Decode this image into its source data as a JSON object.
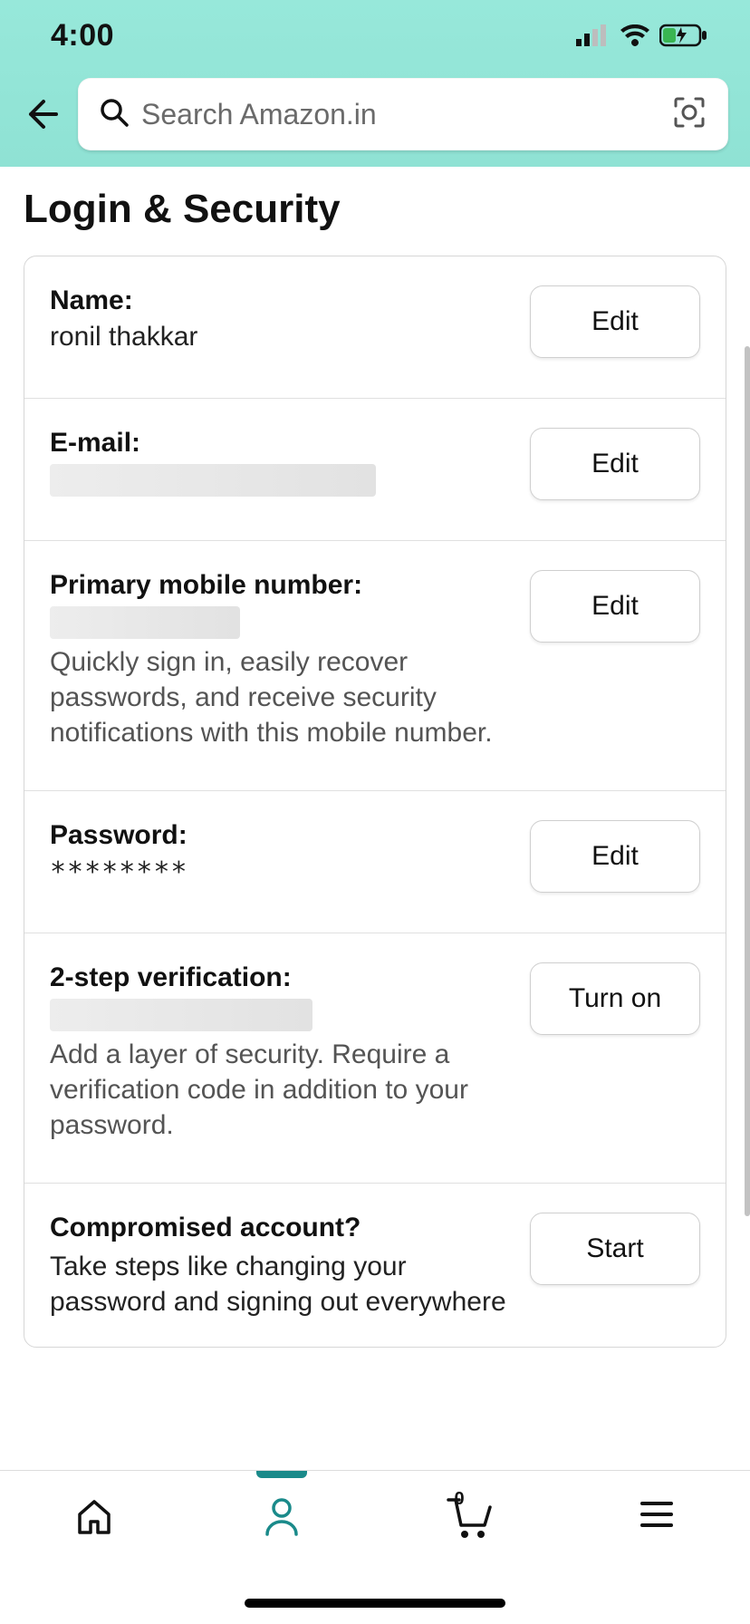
{
  "status": {
    "time": "4:00"
  },
  "search": {
    "placeholder": "Search Amazon.in"
  },
  "page": {
    "title": "Login & Security"
  },
  "rows": {
    "name": {
      "label": "Name:",
      "value": "ronil thakkar",
      "button": "Edit"
    },
    "email": {
      "label": "E-mail:",
      "value": "",
      "button": "Edit"
    },
    "mobile": {
      "label": "Primary mobile number:",
      "value": "",
      "desc": "Quickly sign in, easily recover passwords, and receive security notifications with this mobile number.",
      "button": "Edit"
    },
    "password": {
      "label": "Password:",
      "value": "********",
      "button": "Edit"
    },
    "twostep": {
      "label": "2-step verification:",
      "value": "",
      "desc": "Add a layer of security. Require a verification code in addition to your password.",
      "button": "Turn on"
    },
    "compromised": {
      "label": "Compromised account?",
      "desc": "Take steps like changing your password and signing out everywhere",
      "button": "Start"
    }
  },
  "nav": {
    "cart_count": "0"
  }
}
